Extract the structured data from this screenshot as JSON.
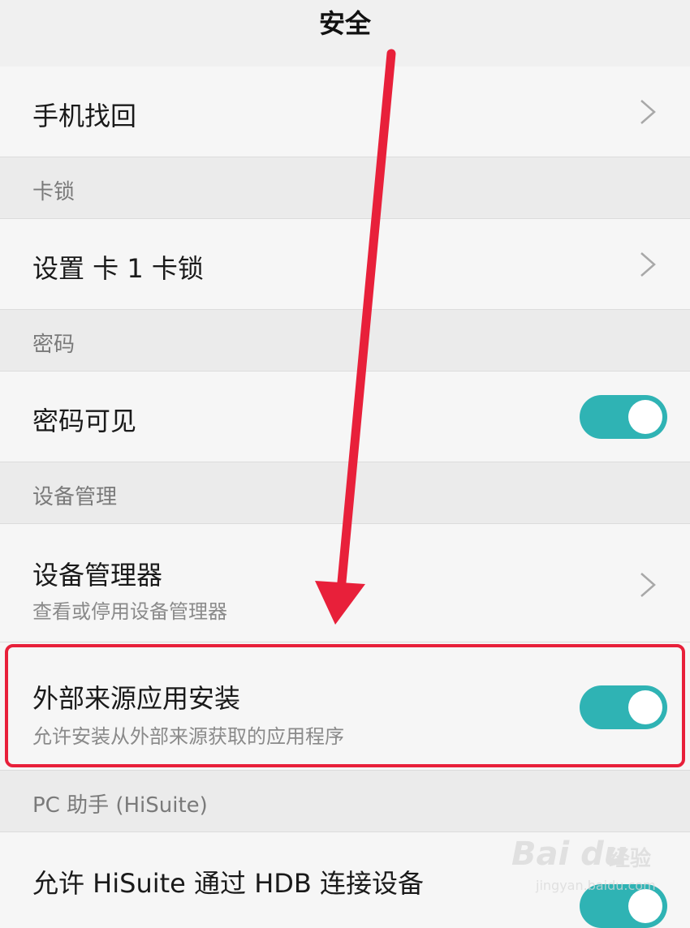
{
  "header": {
    "title": "安全"
  },
  "rows": {
    "find_phone": {
      "title": "手机找回"
    },
    "card_lock_section": {
      "label": "卡锁"
    },
    "set_card_lock": {
      "title": "设置 卡 1 卡锁"
    },
    "password_section": {
      "label": "密码"
    },
    "password_visible": {
      "title": "密码可见",
      "toggle_on": true
    },
    "device_mgmt_section": {
      "label": "设备管理"
    },
    "device_admin": {
      "title": "设备管理器",
      "subtitle": "查看或停用设备管理器"
    },
    "unknown_sources": {
      "title": "外部来源应用安装",
      "subtitle": "允许安装从外部来源获取的应用程序",
      "toggle_on": true
    },
    "pc_section": {
      "label": "PC 助手 (HiSuite)"
    },
    "hisuite_hdb": {
      "title": "允许 HiSuite 通过 HDB 连接设备",
      "toggle_on": true
    }
  },
  "watermark": {
    "logo": "Bai du",
    "text": "经验",
    "sub": "jingyan.baidu.com"
  },
  "colors": {
    "accent": "#2fb3b4",
    "annotation": "#e8203a"
  },
  "icons": {
    "chevron": "chevron-right-icon"
  }
}
